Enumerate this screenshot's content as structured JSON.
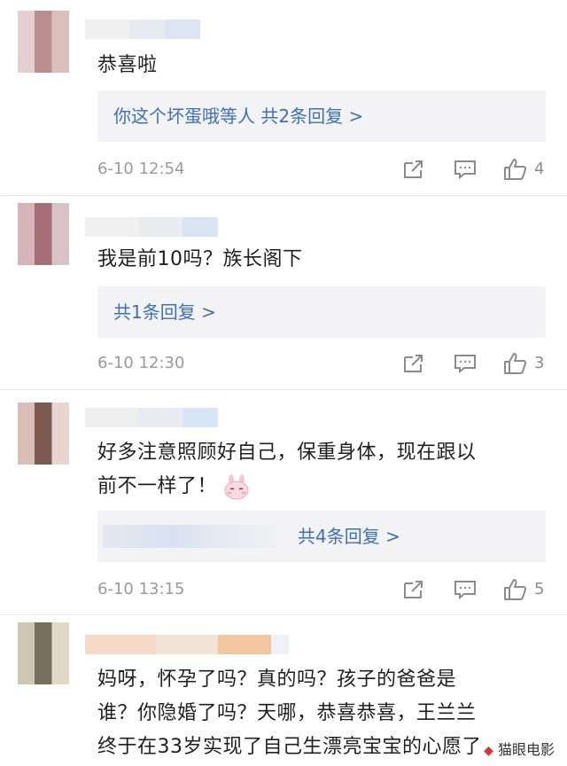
{
  "comments": [
    {
      "text": "恭喜啦",
      "reply": "你这个坏蛋哦等人  共2条回复 >",
      "time": "6-10 12:54",
      "likes": "4"
    },
    {
      "text": "我是前10吗？族长阁下",
      "reply": "共1条回复 >",
      "time": "6-10 12:30",
      "likes": "3"
    },
    {
      "text_line1": "好多注意照顾好自己，保重身体，现在跟以",
      "text_line2": "前不一样了！",
      "reply": "共4条回复 >",
      "time": "6-10 13:15",
      "likes": "5"
    },
    {
      "text_line1": "妈呀，怀孕了吗？真的吗？孩子的爸爸是",
      "text_line2": "谁？你隐婚了吗？天哪，恭喜恭喜，王兰兰",
      "text_line3": "终于在33岁实现了自己生漂亮宝宝的心愿了"
    }
  ],
  "watermark": "猫眼电影",
  "colors": {
    "link": "#3d6fb3",
    "reply_bg": "#f3f3f5",
    "meta": "#9a9a9a"
  },
  "icons": [
    "share-icon",
    "comment-icon",
    "like-icon",
    "bunny-emoji"
  ]
}
